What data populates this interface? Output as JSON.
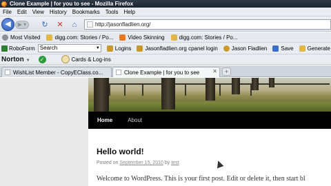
{
  "window": {
    "title": "Clone Example | for you to see - Mozilla Firefox"
  },
  "menu": [
    "File",
    "Edit",
    "View",
    "History",
    "Bookmarks",
    "Tools",
    "Help"
  ],
  "nav": {
    "url": "http://jasonfladlien.org/"
  },
  "bookmarks": [
    {
      "label": "Most Visited",
      "icon": "gear-icon",
      "color": "#8a8f96"
    },
    {
      "label": "digg.com: Stories / Po...",
      "icon": "folder-icon",
      "color": "#e0b84a"
    },
    {
      "label": "Video Skinning",
      "icon": "rss-icon",
      "color": "#e87722"
    },
    {
      "label": "digg.com: Stories / Po...",
      "icon": "folder-icon",
      "color": "#e0b84a"
    }
  ],
  "roboform": {
    "logo": "RoboForm",
    "search_value": "Search",
    "items": [
      {
        "label": "Logins",
        "icon": "lock-icon",
        "color": "#c69a2a"
      },
      {
        "label": "Jasonfladlien.org cpanel login",
        "icon": "key-icon",
        "color": "#c69a2a"
      },
      {
        "label": "Jason Fladlien",
        "icon": "user-icon",
        "color": "#c69a2a"
      },
      {
        "label": "Save",
        "icon": "save-icon",
        "color": "#3a6fc4"
      },
      {
        "label": "Generate",
        "icon": "generate-icon",
        "color": "#e0b84a"
      }
    ]
  },
  "norton": {
    "label": "Norton",
    "cards_label": "Cards & Log-ins"
  },
  "tabs": [
    {
      "label": "WishList Member - CopyEClass.co..."
    },
    {
      "label": "Clone Example | for you to see"
    }
  ],
  "site": {
    "nav_home": "Home",
    "nav_about": "About",
    "post_title": "Hello world!",
    "meta_prefix": "Posted on",
    "meta_date": "September 15, 2010",
    "meta_by": "by",
    "meta_author": "test",
    "body": "Welcome to WordPress. This is your first post. Edit or delete it, then start bl"
  }
}
